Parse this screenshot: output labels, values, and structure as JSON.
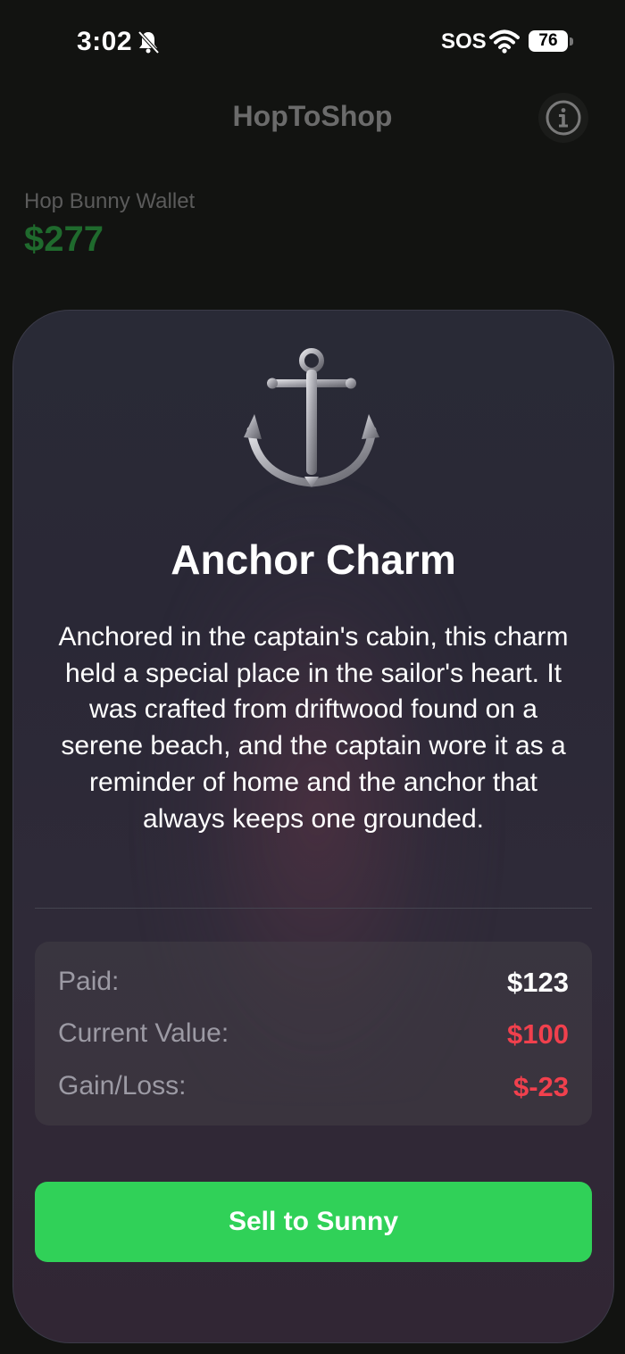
{
  "status_bar": {
    "time": "3:02",
    "sos": "SOS",
    "battery": "76",
    "icons": [
      "bell-slash-icon",
      "wifi-icon",
      "battery-icon"
    ]
  },
  "nav": {
    "title": "HopToShop",
    "info_icon": "info-icon"
  },
  "wallet": {
    "label": "Hop Bunny Wallet",
    "amount": "$277"
  },
  "item": {
    "icon": "anchor-icon",
    "title": "Anchor Charm",
    "description": "Anchored in the captain's cabin, this charm held a special place in the sailor's heart. It was crafted from driftwood found on a serene beach, and the captain wore it as a reminder of home and the anchor that always keeps one grounded."
  },
  "stats": {
    "paid_label": "Paid:",
    "paid_value": "$123",
    "current_label": "Current Value:",
    "current_value": "$100",
    "gain_label": "Gain/Loss:",
    "gain_value": "$-23"
  },
  "actions": {
    "sell_label": "Sell to Sunny"
  },
  "colors": {
    "accent_green": "#30d158",
    "loss_red": "#f1404d",
    "wallet_green": "#1f6a2d"
  }
}
